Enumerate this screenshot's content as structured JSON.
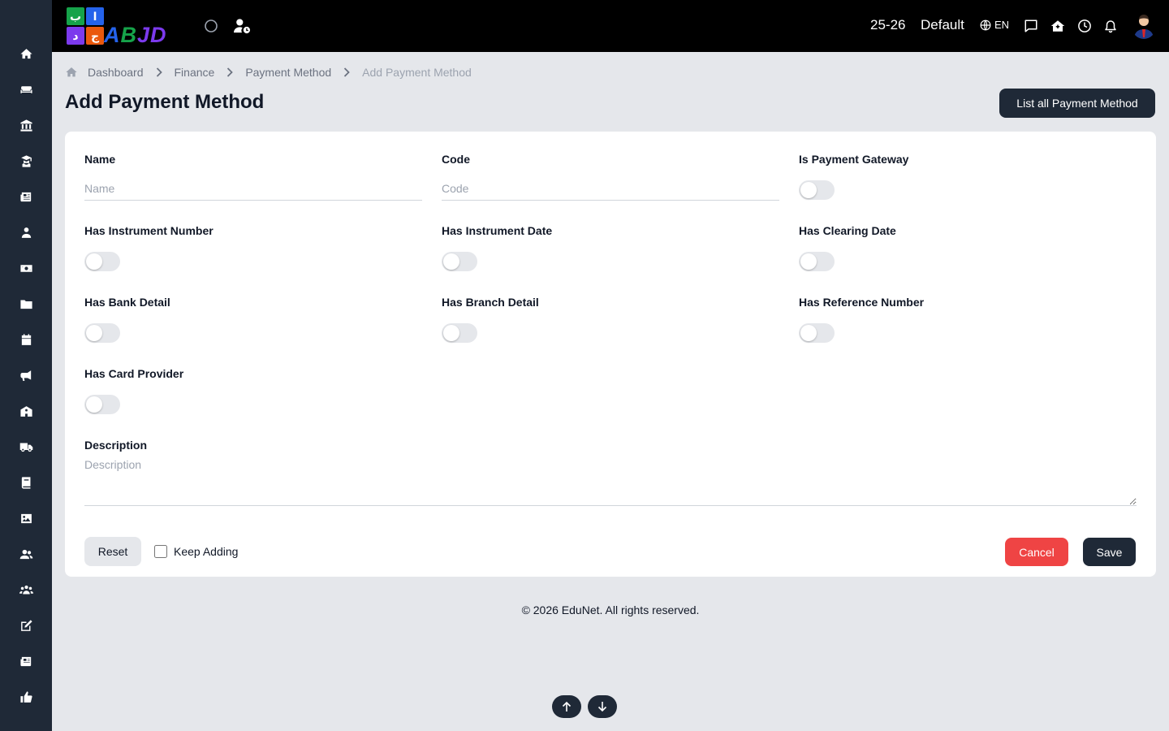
{
  "brand": {
    "logo_word": "ABJD",
    "tile_letters": [
      "ب",
      "ا",
      "د",
      "ج"
    ],
    "colors": {
      "green": "#16a34a",
      "blue": "#2563eb",
      "purple": "#7c3aed",
      "orange": "#ea580c"
    }
  },
  "topbar": {
    "session": "25-26",
    "profile": "Default",
    "lang": "EN"
  },
  "breadcrumb": {
    "items": [
      "Dashboard",
      "Finance",
      "Payment Method",
      "Add Payment Method"
    ]
  },
  "page": {
    "title": "Add Payment Method",
    "list_button": "List all Payment Method"
  },
  "form": {
    "name": {
      "label": "Name",
      "placeholder": "Name",
      "value": ""
    },
    "code": {
      "label": "Code",
      "placeholder": "Code",
      "value": ""
    },
    "toggles": [
      {
        "label": "Is Payment Gateway",
        "on": false
      },
      {
        "label": "Has Instrument Number",
        "on": false
      },
      {
        "label": "Has Instrument Date",
        "on": false
      },
      {
        "label": "Has Clearing Date",
        "on": false
      },
      {
        "label": "Has Bank Detail",
        "on": false
      },
      {
        "label": "Has Branch Detail",
        "on": false
      },
      {
        "label": "Has Reference Number",
        "on": false
      },
      {
        "label": "Has Card Provider",
        "on": false
      }
    ],
    "description": {
      "label": "Description",
      "placeholder": "Description",
      "value": ""
    },
    "reset": "Reset",
    "keep_adding": {
      "label": "Keep Adding",
      "checked": false
    },
    "cancel": "Cancel",
    "save": "Save"
  },
  "footer": "© 2026 EduNet. All rights reserved.",
  "colors": {
    "sidebar": "#1f2937",
    "topbar": "#000000",
    "primary": "#1f2937",
    "danger": "#ef4444",
    "background": "#e5e7eb"
  }
}
